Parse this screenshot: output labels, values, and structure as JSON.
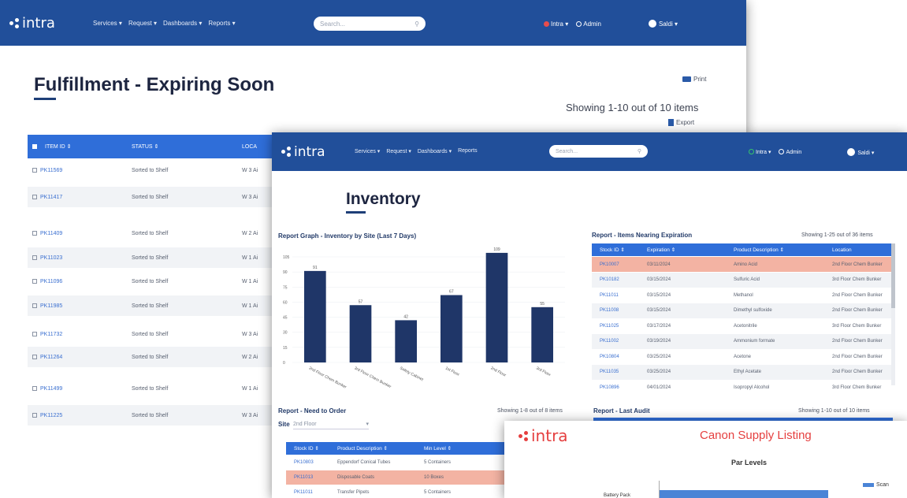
{
  "brand": "intra",
  "nav": {
    "services": "Services",
    "request": "Request",
    "dashboards": "Dashboards",
    "reports": "Reports",
    "caret": "▾",
    "search_placeholder": "Search...",
    "intra_menu": "Intra",
    "admin": "Admin",
    "user": "Saldi"
  },
  "fulfillment": {
    "title": "Fulfillment - Expiring Soon",
    "print": "Print",
    "showing": "Showing 1-10 out of 10 items",
    "export": "Export",
    "columns": [
      "ITEM ID",
      "STATUS",
      "LOCA"
    ],
    "rows": [
      {
        "id": "PK11569",
        "status": "Sorted to Shelf",
        "loc": "W 3 Ai"
      },
      {
        "id": "PK11417",
        "status": "Sorted to Shelf",
        "loc": "W 3 Ai"
      },
      {
        "id": "PK11409",
        "status": "Sorted to Shelf",
        "loc": "W 2 Ai"
      },
      {
        "id": "PK11023",
        "status": "Sorted to Shelf",
        "loc": "W 1 Ai"
      },
      {
        "id": "PK11096",
        "status": "Sorted to Shelf",
        "loc": "W 1 Ai"
      },
      {
        "id": "PK11985",
        "status": "Sorted to Shelf",
        "loc": "W 1 Ai"
      },
      {
        "id": "PK11732",
        "status": "Sorted to Shelf",
        "loc": "W 3 Ai"
      },
      {
        "id": "PK11264",
        "status": "Sorted to Shelf",
        "loc": "W 2 Ai"
      },
      {
        "id": "PK11499",
        "status": "Sorted to Shelf",
        "loc": "W 1 Ai"
      },
      {
        "id": "PK11225",
        "status": "Sorted to Shelf",
        "loc": "W 3 Ai"
      }
    ]
  },
  "inventory": {
    "title": "Inventory",
    "graph_title": "Report Graph - Inventory by Site (Last 7 Days)",
    "expiration": {
      "title": "Report - Items Nearing Expiration",
      "showing": "Showing 1-25 out of 36 items",
      "columns": [
        "Stock ID",
        "Expiration",
        "Product Description",
        "Location"
      ],
      "rows": [
        {
          "id": "PK10007",
          "date": "03/11/2024",
          "desc": "Amino Acid",
          "loc": "2nd Floor Chem Bunker",
          "hl": true
        },
        {
          "id": "PK10182",
          "date": "03/15/2024",
          "desc": "Sulfuric Acid",
          "loc": "3rd Floor Chem Bunker",
          "hl": false
        },
        {
          "id": "PK11011",
          "date": "03/15/2024",
          "desc": "Methanol",
          "loc": "2nd Floor Chem Bunker",
          "hl": false
        },
        {
          "id": "PK11008",
          "date": "03/15/2024",
          "desc": "Dimethyl sulfoxide",
          "loc": "2nd Floor Chem Bunker",
          "hl": false
        },
        {
          "id": "PK11025",
          "date": "03/17/2024",
          "desc": "Acetonitrile",
          "loc": "3rd Floor Chem Bunker",
          "hl": false
        },
        {
          "id": "PK11002",
          "date": "03/19/2024",
          "desc": "Ammonium formate",
          "loc": "2nd Floor Chem Bunker",
          "hl": false
        },
        {
          "id": "PK10804",
          "date": "03/25/2024",
          "desc": "Acetone",
          "loc": "2nd Floor Chem Bunker",
          "hl": false
        },
        {
          "id": "PK11035",
          "date": "03/25/2024",
          "desc": "Ethyl Acetate",
          "loc": "2nd Floor Chem Bunker",
          "hl": false
        },
        {
          "id": "PK10896",
          "date": "04/01/2024",
          "desc": "Isopropyl Alcohol",
          "loc": "3rd Floor Chem Bunker",
          "hl": false
        }
      ]
    },
    "need": {
      "title": "Report - Need to Order",
      "showing": "Showing 1-8 out of 8 items",
      "site_label": "Site",
      "site_value": "2nd Floor",
      "columns": [
        "Stock ID",
        "Product Description",
        "Min Level"
      ],
      "rows": [
        {
          "id": "PK10803",
          "desc": "Eppendorf Conical Tubes",
          "min": "5 Containers",
          "hl": false
        },
        {
          "id": "PK11013",
          "desc": "Disposable Coats",
          "min": "10 Boxes",
          "hl": true
        },
        {
          "id": "PK11011",
          "desc": "Transfer Pipets",
          "min": "5 Containers",
          "hl": false
        }
      ]
    },
    "audit": {
      "title": "Report - Last Audit",
      "showing": "Showing 1-10 out of 10 items"
    }
  },
  "canon": {
    "title": "Canon Supply Listing",
    "chart_title": "Par Levels",
    "legend": "Scan",
    "bar_label": "Battery Pack"
  },
  "chart_data": {
    "type": "bar",
    "title": "Report Graph - Inventory by Site (Last 7 Days)",
    "categories": [
      "2nd Floor Chem Bunker",
      "3rd Floor Chem Bunker",
      "Safety Cabinet",
      "1st Floor",
      "2nd Floor",
      "3rd Floor"
    ],
    "values": [
      91,
      57,
      42,
      67,
      109,
      55
    ],
    "ylim": [
      0,
      105
    ],
    "yticks": [
      0,
      15,
      30,
      45,
      60,
      75,
      90,
      105
    ],
    "color": "#1f3668"
  },
  "colors": {
    "nav": "#214f9a",
    "table_head": "#2f6ed9",
    "highlight": "#f3b3a3",
    "bar": "#1f3668",
    "canon_red": "#e53f3f"
  }
}
